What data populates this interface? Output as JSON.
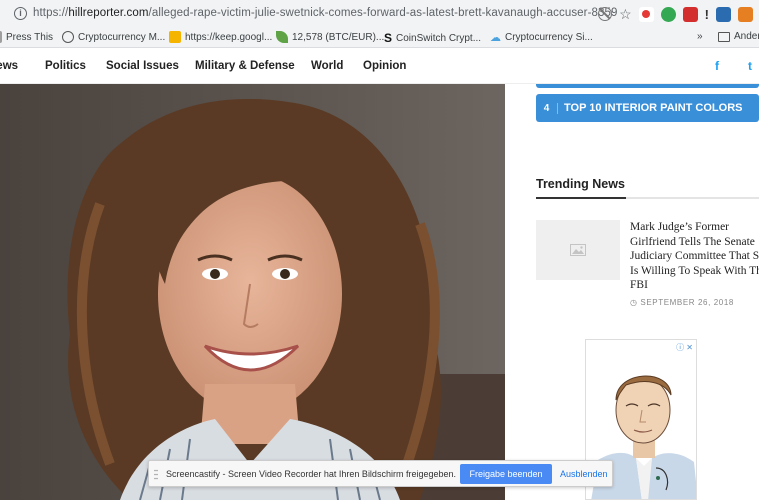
{
  "browser": {
    "url_scheme": "https://",
    "url_host": "hillreporter.com",
    "url_path": "/alleged-rape-victim-julie-swetnick-comes-forward-as-latest-brett-kavanaugh-accuser-8359"
  },
  "bookmarks": {
    "items": [
      {
        "label": "Press This",
        "icon": "press-this-icon",
        "color": "#777777"
      },
      {
        "label": "Cryptocurrency M...",
        "icon": "cryptocurrency-icon",
        "color": "#555555"
      },
      {
        "label": "https://keep.googl...",
        "icon": "google-keep-icon",
        "color": "#f4b400"
      },
      {
        "label": "12,578 (BTC/EUR)...",
        "icon": "leaf-icon",
        "color": "#5fa346"
      },
      {
        "label": "CoinSwitch Crypt...",
        "icon": "coinswitch-icon",
        "color": "#222222"
      },
      {
        "label": "Cryptocurrency Si...",
        "icon": "cloud-icon",
        "color": "#4aa3df"
      }
    ],
    "overflow": "»",
    "other_folder": "Andere"
  },
  "nav": {
    "items": [
      "News",
      "Politics",
      "Social Issues",
      "Military & Defense",
      "World",
      "Opinion"
    ],
    "social": [
      "f",
      "t"
    ]
  },
  "sidebar": {
    "top_list_item": {
      "number": "4",
      "label": "TOP 10 INTERIOR PAINT COLORS"
    },
    "trending_title": "Trending News",
    "article": {
      "title": "Mark Judge’s Former Girlfriend Tells The Senate Judiciary Committee That She Is Willing To Speak With The FBI",
      "date": "SEPTEMBER 26, 2018"
    },
    "ad_badge": "ⓘ ✕"
  },
  "banner": {
    "text": "Screencastify - Screen Video Recorder hat Ihren Bildschirm freigegeben.",
    "stop_label": "Freigabe beenden",
    "hide_label": "Ausblenden"
  },
  "colors": {
    "accent_blue": "#3a8fd9",
    "button_blue": "#4a8af4"
  }
}
